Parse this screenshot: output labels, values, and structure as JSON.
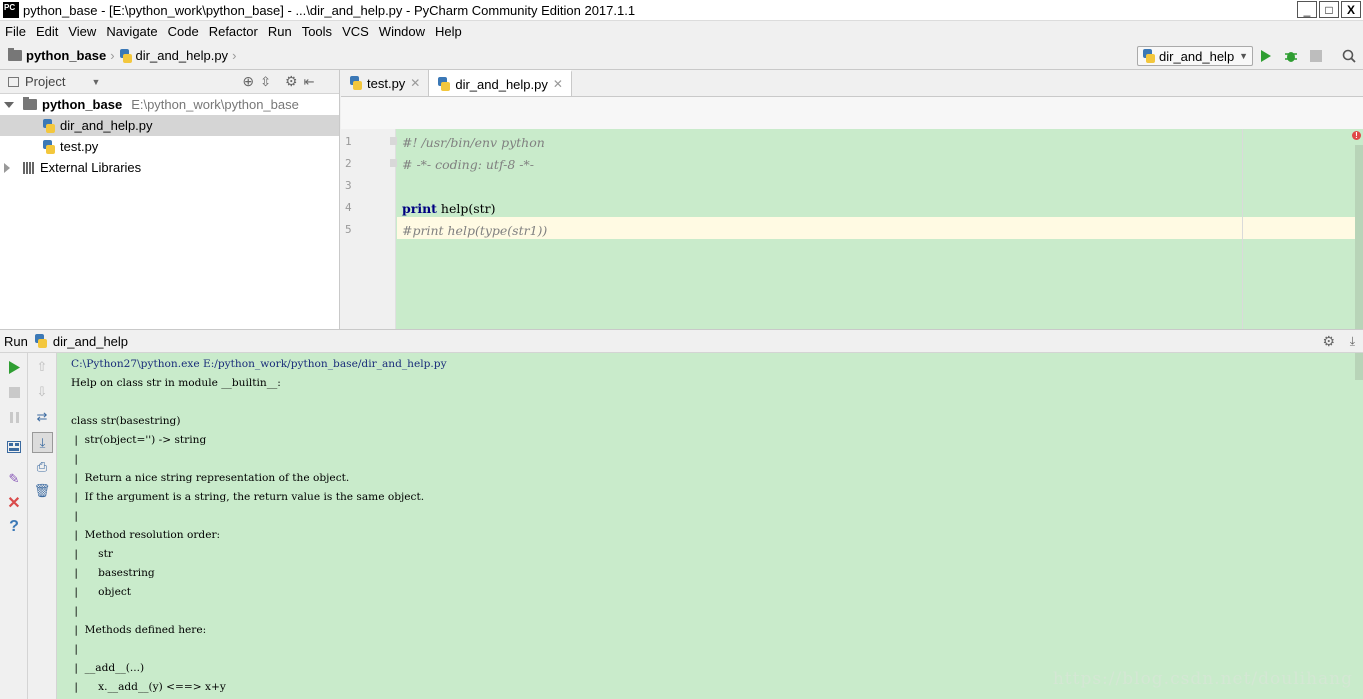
{
  "window": {
    "title": "python_base - [E:\\python_work\\python_base] - ...\\dir_and_help.py - PyCharm Community Edition 2017.1.1",
    "icon_text": "PC",
    "minimize": "_",
    "maximize": "□",
    "close": "X"
  },
  "menu": [
    "File",
    "Edit",
    "View",
    "Navigate",
    "Code",
    "Refactor",
    "Run",
    "Tools",
    "VCS",
    "Window",
    "Help"
  ],
  "nav": {
    "project": "python_base",
    "file": "dir_and_help.py",
    "run_config": "dir_and_help"
  },
  "project_pane": {
    "header": "Project",
    "root_name": "python_base",
    "root_path": "E:\\python_work\\python_base",
    "files": [
      "dir_and_help.py",
      "test.py"
    ],
    "libraries": "External Libraries"
  },
  "editor": {
    "tabs": [
      {
        "label": "test.py",
        "active": false
      },
      {
        "label": "dir_and_help.py",
        "active": true
      }
    ],
    "lines": [
      {
        "no": "1",
        "text": "#! /usr/bin/env python",
        "kind": "comment"
      },
      {
        "no": "2",
        "text": "# -*- coding: utf-8 -*-",
        "kind": "comment"
      },
      {
        "no": "3",
        "text": "",
        "kind": "code"
      },
      {
        "no": "4",
        "text": "print help(str)",
        "kind": "code"
      },
      {
        "no": "5",
        "text": "#print help(type(str1))",
        "kind": "comment"
      }
    ],
    "print_kw": "print",
    "print_rest": " help(str)"
  },
  "run_panel": {
    "label": "Run",
    "config": "dir_and_help",
    "console_lines": [
      "C:\\Python27\\python.exe E:/python_work/python_base/dir_and_help.py",
      "Help on class str in module __builtin__:",
      "",
      "class str(basestring)",
      " |  str(object='') -> string",
      " |",
      " |  Return a nice string representation of the object.",
      " |  If the argument is a string, the return value is the same object.",
      " |",
      " |  Method resolution order:",
      " |      str",
      " |      basestring",
      " |      object",
      " |",
      " |  Methods defined here:",
      " |",
      " |  __add__(...)",
      " |      x.__add__(y) <==> x+y"
    ]
  },
  "watermark": "https://blog.csdn.net/doulihang",
  "colors": {
    "editor_bg": "#c9ebcb",
    "caret_line": "#fffae3",
    "run_green": "#2f9e32",
    "error_red": "#e04848"
  }
}
